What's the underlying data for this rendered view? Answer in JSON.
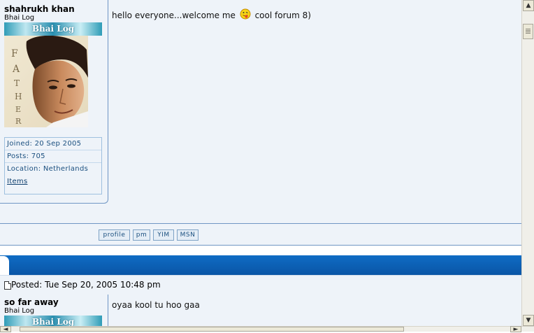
{
  "posts": [
    {
      "username": "shahrukh khan",
      "rank": "Bhai Log",
      "rank_image_text": "Bhai Log",
      "avatar_letters": "FATHER",
      "joined": "Joined: 20 Sep 2005",
      "posts": "Posts: 705",
      "location": "Location: Netherlands",
      "items_link": "Items",
      "message_before": "hello everyone...welcome me",
      "message_after": "cool forum 8)",
      "buttons": [
        "profile",
        "pm",
        "YIM",
        "MSN"
      ]
    },
    {
      "posted": "Posted: Tue Sep 20, 2005 10:48 pm",
      "username": "so far away",
      "rank": "Bhai Log",
      "rank_image_text": "Bhai Log",
      "message": "oyaa kool tu hoo gaa"
    }
  ],
  "icons": {
    "smiley": "tongue-smiley-icon",
    "post": "post-document-icon"
  },
  "scrollbars": {
    "up": "▲",
    "down": "▼",
    "left": "◄",
    "right": "►"
  },
  "colors": {
    "background": "#eef3f9",
    "border": "#6f96c4",
    "header_bar": "#0a55a6",
    "link": "#1a4f7f"
  }
}
